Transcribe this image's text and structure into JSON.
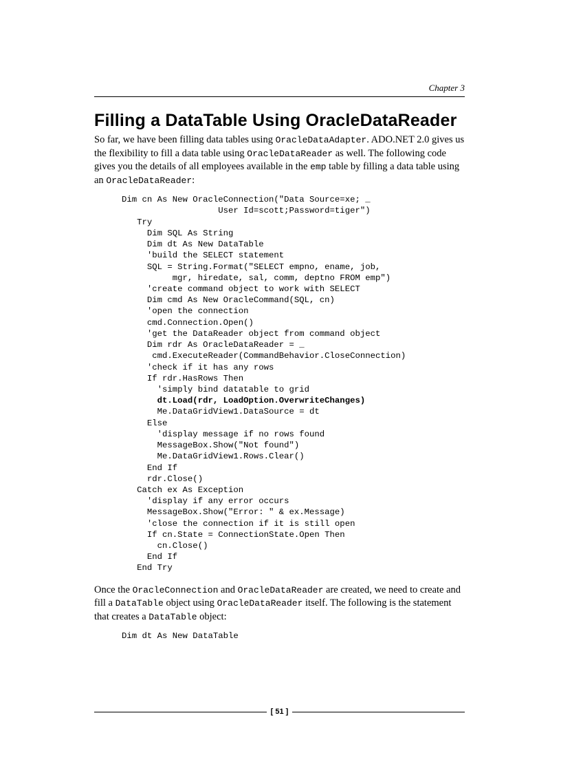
{
  "chapter": "Chapter 3",
  "title": "Filling a DataTable Using OracleDataReader",
  "intro": {
    "t1": "So far, we have been filling data tables using ",
    "c1": "OracleDataAdapter",
    "t2": ". ADO.NET 2.0 gives us the flexibility to fill a data table using ",
    "c2": "OracleDataReader",
    "t3": " as well. The following code gives you the details of all employees available in the ",
    "c3": "emp",
    "t4": " table by filling a data table using an ",
    "c4": "OracleDataReader",
    "t5": ":"
  },
  "code1": {
    "l1": "Dim cn As New OracleConnection(\"Data Source=xe; _",
    "l2": "                   User Id=scott;Password=tiger\")",
    "l3": "   Try",
    "l4": "     Dim SQL As String",
    "l5": "     Dim dt As New DataTable",
    "l6": "     'build the SELECT statement",
    "l7": "     SQL = String.Format(\"SELECT empno, ename, job,",
    "l8": "          mgr, hiredate, sal, comm, deptno FROM emp\")",
    "l9": "     'create command object to work with SELECT",
    "l10": "     Dim cmd As New OracleCommand(SQL, cn)",
    "l11": "     'open the connection",
    "l12": "     cmd.Connection.Open()",
    "l13": "     'get the DataReader object from command object",
    "l14": "     Dim rdr As OracleDataReader = _",
    "l15": "      cmd.ExecuteReader(CommandBehavior.CloseConnection)",
    "l16": "     'check if it has any rows",
    "l17": "     If rdr.HasRows Then",
    "l18": "       'simply bind datatable to grid",
    "l19": "       dt.Load(rdr, LoadOption.OverwriteChanges)",
    "l20": "       Me.DataGridView1.DataSource = dt",
    "l21": "     Else",
    "l22": "       'display message if no rows found",
    "l23": "       MessageBox.Show(\"Not found\")",
    "l24": "       Me.DataGridView1.Rows.Clear()",
    "l25": "     End If",
    "l26": "     rdr.Close()",
    "l27": "   Catch ex As Exception",
    "l28": "     'display if any error occurs",
    "l29": "     MessageBox.Show(\"Error: \" & ex.Message)",
    "l30": "     'close the connection if it is still open",
    "l31": "     If cn.State = ConnectionState.Open Then",
    "l32": "       cn.Close()",
    "l33": "     End If",
    "l34": "   End Try"
  },
  "mid": {
    "t1": "Once the ",
    "c1": "OracleConnection",
    "t2": " and ",
    "c2": "OracleDataReader",
    "t3": " are created, we need to create and fill a ",
    "c3": "DataTable",
    "t4": " object using ",
    "c4": "OracleDataReader",
    "t5": " itself. The following is the statement that creates a ",
    "c5": "DataTable",
    "t6": " object:"
  },
  "code2": "Dim dt As New DataTable",
  "pageNumber": "[ 51 ]"
}
